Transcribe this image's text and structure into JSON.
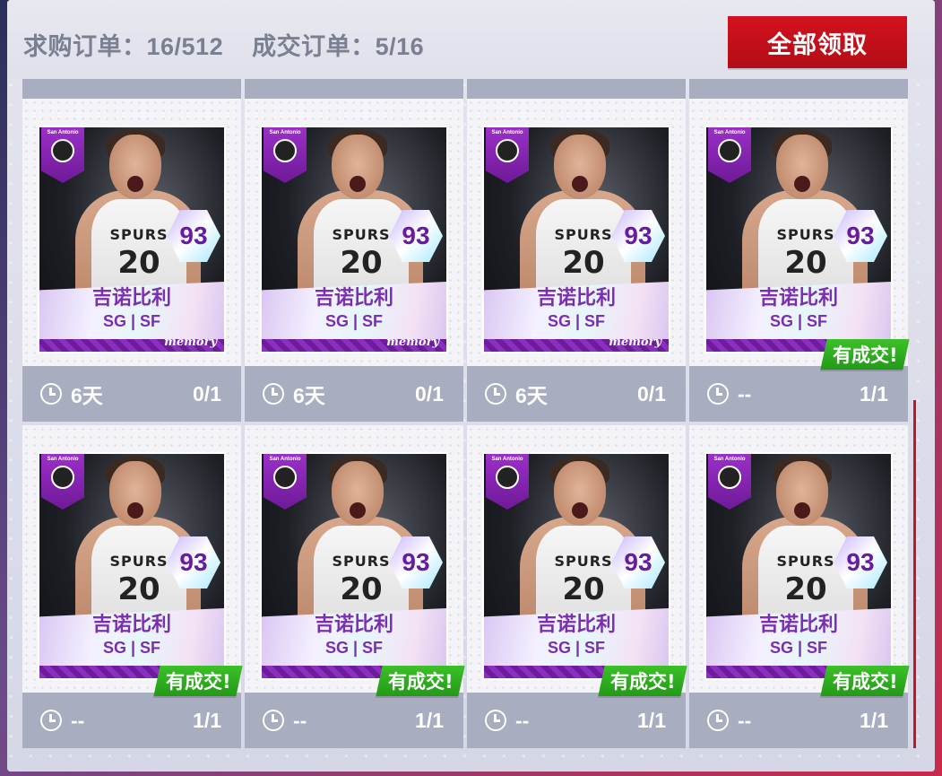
{
  "header": {
    "buy_orders_label": "求购订单：16/512",
    "deals_label": "成交订单：5/16",
    "claim_all_label": "全部领取"
  },
  "card_template": {
    "city": "San Antonio",
    "rating": "93",
    "player_name": "吉诺比利",
    "positions": "SG | SF",
    "series": "memory",
    "jersey_team": "SPURS",
    "jersey_number": "20",
    "deal_badge": "有成交!"
  },
  "orders": [
    {
      "time": "6天",
      "progress": "0/1",
      "has_deal": false
    },
    {
      "time": "6天",
      "progress": "0/1",
      "has_deal": false
    },
    {
      "time": "6天",
      "progress": "0/1",
      "has_deal": false
    },
    {
      "time": "--",
      "progress": "1/1",
      "has_deal": true
    },
    {
      "time": "--",
      "progress": "1/1",
      "has_deal": true
    },
    {
      "time": "--",
      "progress": "1/1",
      "has_deal": true
    },
    {
      "time": "--",
      "progress": "1/1",
      "has_deal": true
    },
    {
      "time": "--",
      "progress": "1/1",
      "has_deal": true
    }
  ],
  "colors": {
    "claim_button": "#c8101c",
    "deal_badge": "#2fae20",
    "card_accent": "#7a2fb0",
    "footer_bg": "#a8adbf"
  }
}
